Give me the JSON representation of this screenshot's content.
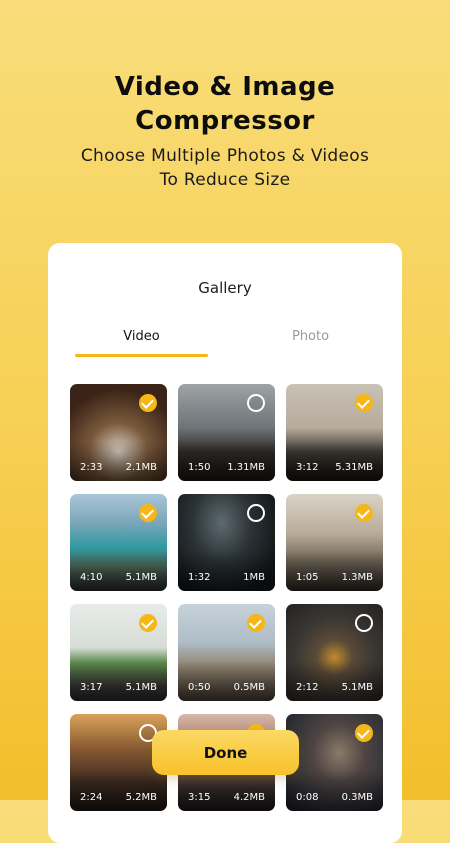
{
  "hero": {
    "title_line1": "Video & Image",
    "title_line2": "Compressor",
    "subtitle_line1": "Choose Multiple Photos & Videos",
    "subtitle_line2": "To Reduce Size"
  },
  "gallery": {
    "title": "Gallery",
    "tabs": [
      {
        "label": "Video",
        "active": true
      },
      {
        "label": "Photo",
        "active": false
      }
    ],
    "items": [
      {
        "duration": "2:33",
        "size": "2.1MB",
        "selected": true
      },
      {
        "duration": "1:50",
        "size": "1.31MB",
        "selected": false
      },
      {
        "duration": "3:12",
        "size": "5.31MB",
        "selected": true
      },
      {
        "duration": "4:10",
        "size": "5.1MB",
        "selected": true
      },
      {
        "duration": "1:32",
        "size": "1MB",
        "selected": false
      },
      {
        "duration": "1:05",
        "size": "1.3MB",
        "selected": true
      },
      {
        "duration": "3:17",
        "size": "5.1MB",
        "selected": true
      },
      {
        "duration": "0:50",
        "size": "0.5MB",
        "selected": true
      },
      {
        "duration": "2:12",
        "size": "5.1MB",
        "selected": false
      },
      {
        "duration": "2:24",
        "size": "5.2MB",
        "selected": false
      },
      {
        "duration": "3:15",
        "size": "4.2MB",
        "selected": true
      },
      {
        "duration": "0:08",
        "size": "0.3MB",
        "selected": true
      }
    ]
  },
  "done_label": "Done",
  "colors": {
    "accent": "#F5B718",
    "background_top": "#F8DD7A",
    "background_bottom": "#F3BE2C"
  }
}
